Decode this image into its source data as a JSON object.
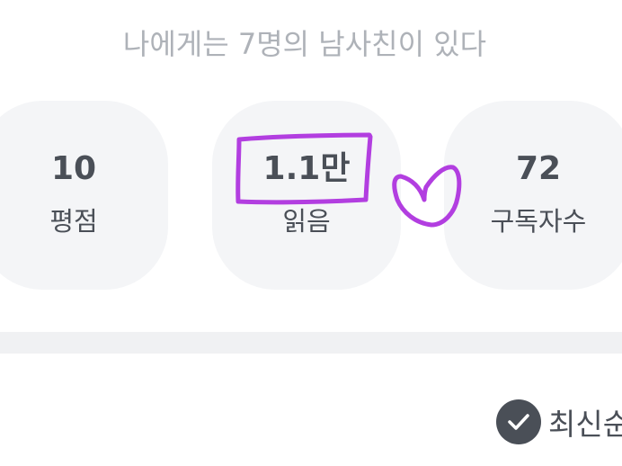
{
  "header": {
    "subtitle": "나에게는 7명의 남사친이 있다"
  },
  "stats": [
    {
      "value": "10",
      "label": "평점"
    },
    {
      "value": "1.1만",
      "label": "읽음"
    },
    {
      "value": "72",
      "label": "구독자수"
    }
  ],
  "sort": {
    "label": "최신순",
    "icon": "check-icon"
  },
  "colors": {
    "card_bg": "#f4f5f7",
    "text_dark": "#4a4f57",
    "text_muted": "#aeb2b8",
    "annotation": "#b23ee0"
  }
}
